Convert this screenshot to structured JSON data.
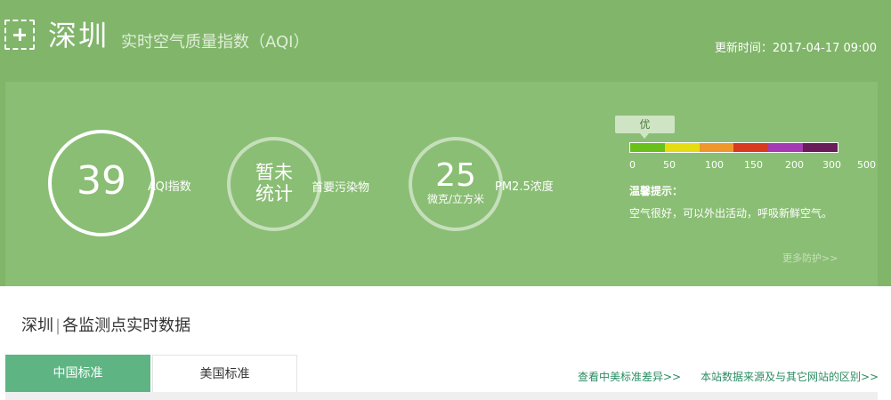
{
  "header": {
    "city": "深圳",
    "subtitle": "实时空气质量指数（AQI）",
    "update_time": "更新时间：2017-04-17 09:00"
  },
  "metrics": {
    "aqi": {
      "value": "39",
      "label": "AQI指数"
    },
    "primary_pollutant": {
      "value": "暂未统计",
      "label": "首要污染物"
    },
    "pm25": {
      "value": "25",
      "unit": "微克/立方米",
      "label": "PM2.5浓度"
    }
  },
  "scale": {
    "level_label": "优",
    "colors": [
      "#69c01a",
      "#e6dc12",
      "#f0972b",
      "#d8391f",
      "#a53bb3",
      "#6a1c5a"
    ],
    "ticks": [
      "0",
      "50",
      "100",
      "150",
      "200",
      "300",
      "500"
    ]
  },
  "tip": {
    "title": "温馨提示：",
    "text": "空气很好，可以外出活动，呼吸新鲜空气。",
    "more": "更多防护>>"
  },
  "section": {
    "city": "深圳",
    "divider": "|",
    "title": "各监测点实时数据",
    "tabs": [
      "中国标准",
      "美国标准"
    ],
    "link_diff": "查看中美标准差异>>",
    "link_source": "本站数据来源及与其它网站的区别>>"
  }
}
